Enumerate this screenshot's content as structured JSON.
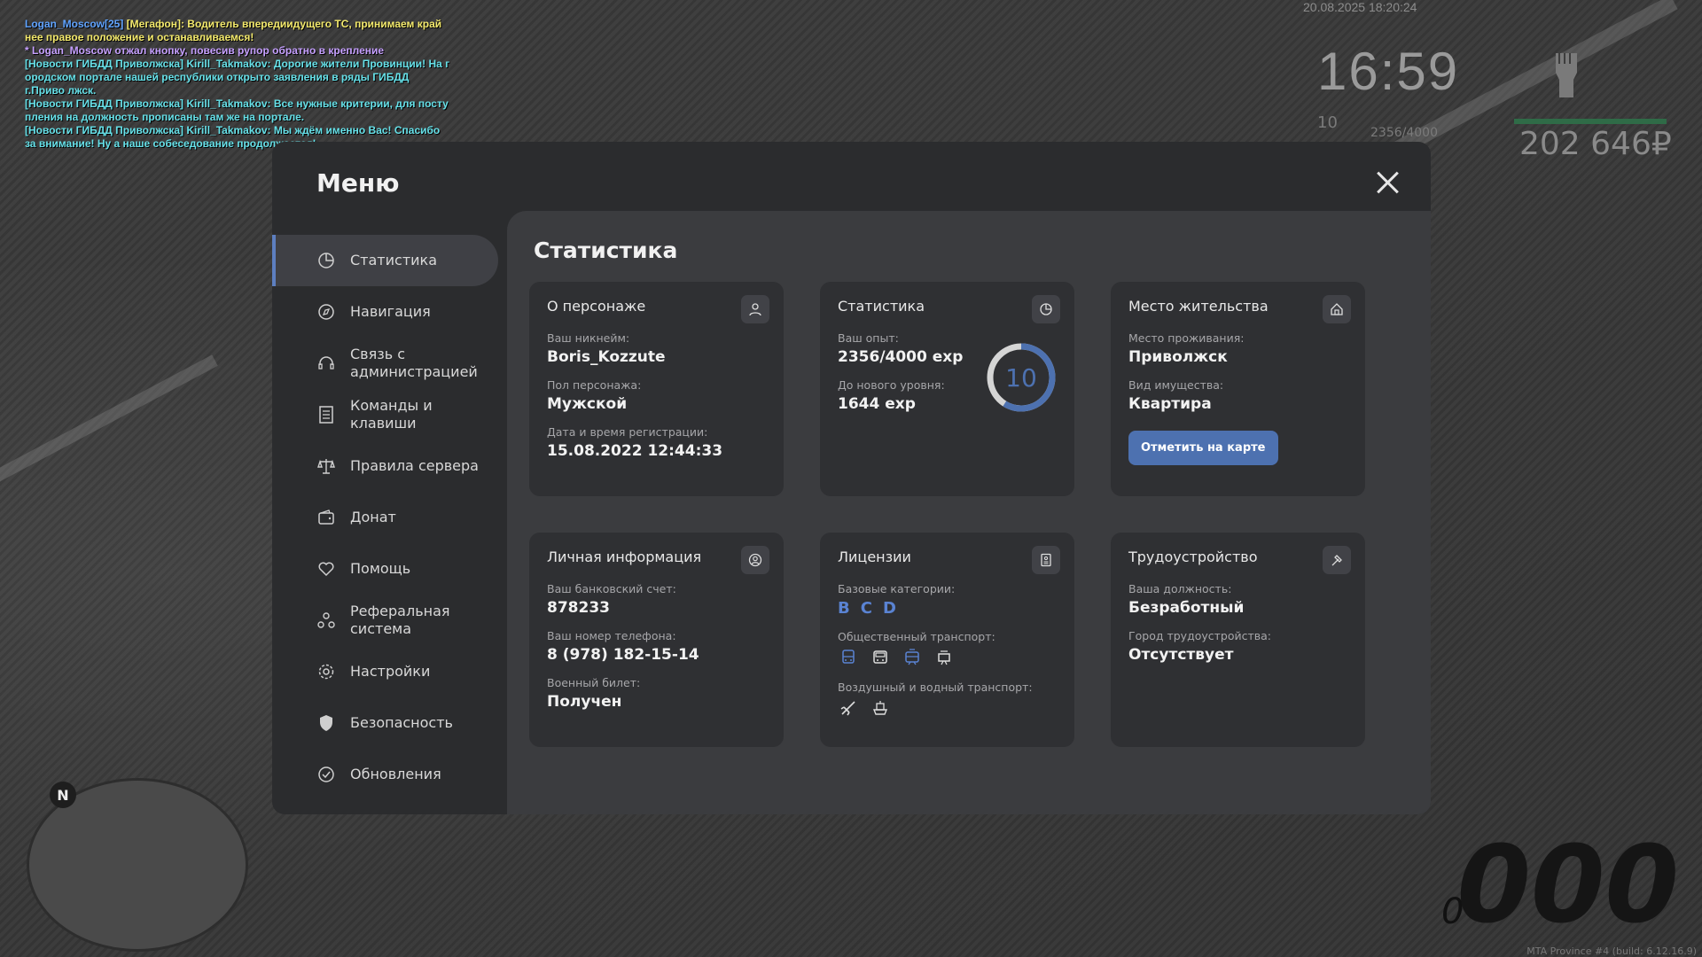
{
  "chat": [
    {
      "parts": [
        {
          "t": "Logan_Moscow[25] ",
          "c": "c-blue"
        },
        {
          "t": "[Мегафон]: Водитель впередиидущего ТС, принимаем край нее правое положение и останавливаемся!",
          "c": "c-yellow"
        }
      ]
    },
    {
      "parts": [
        {
          "t": "* Logan_Moscow отжал кнопку, повесив рупор обратно в крепление",
          "c": "c-purple"
        }
      ]
    },
    {
      "parts": [
        {
          "t": "[Новости ГИБДД Приволжска] Kirill_Takmakov: Дорогие жители Провинции! На г ородском портале нашей республики открыто заявления в ряды ГИБДД г.Приво лжск.",
          "c": "c-cyan"
        }
      ]
    },
    {
      "parts": [
        {
          "t": "[Новости ГИБДД Приволжска] Kirill_Takmakov: Все нужные критерии, для посту пления на должность прописаны там же на портале.",
          "c": "c-cyan"
        }
      ]
    },
    {
      "parts": [
        {
          "t": "[Новости ГИБДД Приволжска] Kirill_Takmakov: Мы ждём именно Вас! Спасибо за внимание! Ну а наше собеседование продолжается!",
          "c": "c-cyan"
        }
      ]
    }
  ],
  "hud": {
    "date": "20.08.2025 18:20:24",
    "time": "16:59",
    "level": "10",
    "exp": "2356/4000",
    "money": "202 646₽",
    "speed": "000",
    "gear": "0",
    "build": "MTA Province #4 (build: 6.12.16.9)",
    "north": "N"
  },
  "menu": {
    "title": "Меню",
    "nav": [
      {
        "label": "Статистика",
        "icon": "pie-chart-icon",
        "active": true
      },
      {
        "label": "Навигация",
        "icon": "compass-icon"
      },
      {
        "label": "Связь с\nадминистрацией",
        "icon": "headset-icon"
      },
      {
        "label": "Команды и\nклавиши",
        "icon": "document-list-icon"
      },
      {
        "label": "Правила сервера",
        "icon": "scales-icon"
      },
      {
        "label": "Донат",
        "icon": "wallet-icon"
      },
      {
        "label": "Помощь",
        "icon": "heart-hand-icon"
      },
      {
        "label": "Реферальная\nсистема",
        "icon": "referral-icon"
      },
      {
        "label": "Настройки",
        "icon": "gear-icon"
      },
      {
        "label": "Безопасность",
        "icon": "shield-icon"
      },
      {
        "label": "Обновления",
        "icon": "refresh-check-icon"
      }
    ]
  },
  "content": {
    "title": "Статистика",
    "cards": {
      "character": {
        "title": "О персонаже",
        "icon": "user-icon",
        "fields": [
          {
            "label": "Ваш никнейм:",
            "value": "Boris_Kozzute"
          },
          {
            "label": "Пол персонажа:",
            "value": "Мужской"
          },
          {
            "label": "Дата и время регистрации:",
            "value": "15.08.2022 12:44:33"
          }
        ]
      },
      "stats": {
        "title": "Статистика",
        "icon": "pie-chart-icon",
        "fields": [
          {
            "label": "Ваш опыт:",
            "value": "2356/4000 exp"
          },
          {
            "label": "До нового уровня:",
            "value": "1644 exp"
          }
        ],
        "level": "10",
        "progress": 0.589
      },
      "residence": {
        "title": "Место жительства",
        "icon": "house-icon",
        "fields": [
          {
            "label": "Место проживания:",
            "value": "Приволжск"
          },
          {
            "label": "Вид имущества:",
            "value": "Квартира"
          }
        ],
        "button": "Отметить на карте"
      },
      "personal": {
        "title": "Личная информация",
        "icon": "user-circle-icon",
        "fields": [
          {
            "label": "Ваш банковский счет:",
            "value": "878233"
          },
          {
            "label": "Ваш номер телефона:",
            "value": "8 (978) 182-15-14"
          },
          {
            "label": "Военный билет:",
            "value": "Получен"
          }
        ]
      },
      "licenses": {
        "title": "Лицензии",
        "icon": "license-card-icon",
        "base_label": "Базовые категории:",
        "categories": [
          "B",
          "C",
          "D"
        ],
        "public_label": "Общественный транспорт:",
        "public_icons": [
          "bus-icon",
          "coach-icon",
          "tram-icon",
          "train-icon"
        ],
        "air_label": "Воздушный и водный транспорт:",
        "air_icons": [
          "airplane-icon",
          "boat-icon"
        ]
      },
      "employment": {
        "title": "Трудоустройство",
        "icon": "hammer-icon",
        "fields": [
          {
            "label": "Ваша должность:",
            "value": "Безработный"
          },
          {
            "label": "Город трудоустройства:",
            "value": "Отсутствует"
          }
        ]
      }
    }
  },
  "colors": {
    "accent": "#5d7fc0",
    "button": "#4d71b0",
    "category": "#5a83d3"
  }
}
